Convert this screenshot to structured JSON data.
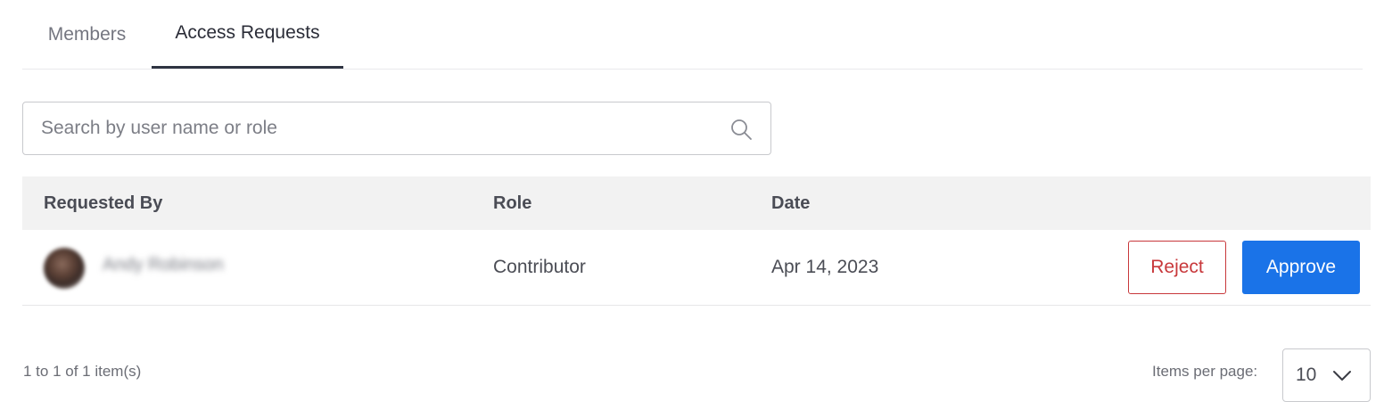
{
  "tabs": [
    {
      "label": "Members",
      "active": false
    },
    {
      "label": "Access Requests",
      "active": true
    }
  ],
  "search": {
    "placeholder": "Search by user name or role",
    "value": "",
    "icon": "search-icon"
  },
  "table": {
    "columns": [
      "Requested By",
      "Role",
      "Date"
    ],
    "rows": [
      {
        "requested_by": "Andy Robinson",
        "role": "Contributor",
        "date": "Apr 14, 2023",
        "reject_label": "Reject",
        "approve_label": "Approve"
      }
    ]
  },
  "footer": {
    "range_text": "1 to 1 of 1 item(s)",
    "per_page_label": "Items per page:",
    "per_page_value": "10"
  },
  "colors": {
    "approve": "#1a73e8",
    "reject": "#c8383b",
    "header_bg": "#f2f2f2"
  }
}
